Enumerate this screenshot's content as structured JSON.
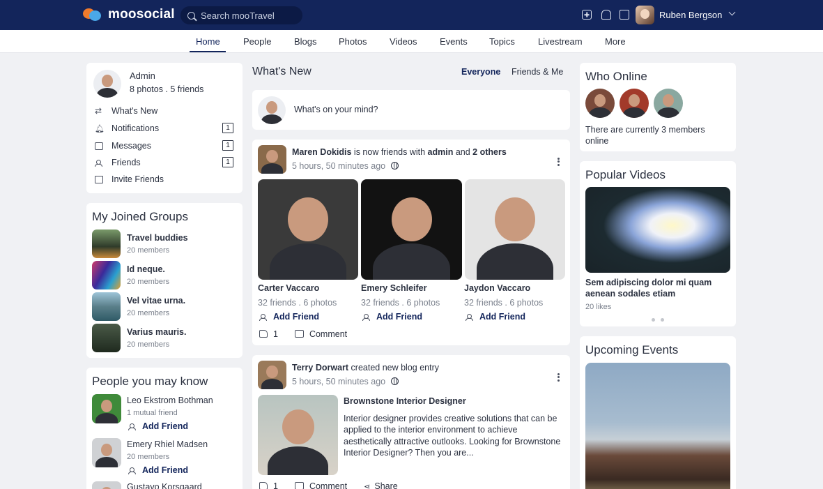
{
  "header": {
    "brand": "moosocial",
    "search_placeholder": "Search mooTravel",
    "user_name": "Ruben Bergson",
    "icons": [
      "plus-icon",
      "bell-icon",
      "chat-icon",
      "chevron-down-icon"
    ]
  },
  "nav": {
    "items": [
      "Home",
      "People",
      "Blogs",
      "Photos",
      "Videos",
      "Events",
      "Topics",
      "Livestream",
      "More"
    ],
    "active": "Home"
  },
  "profile": {
    "name": "Admin",
    "stats": "8 photos . 5 friends",
    "menu": [
      {
        "label": "What's New",
        "icon": "arrows-icon",
        "count": ""
      },
      {
        "label": "Notifications",
        "icon": "bell-icon",
        "count": "1"
      },
      {
        "label": "Messages",
        "icon": "message-icon",
        "count": "1"
      },
      {
        "label": "Friends",
        "icon": "friends-icon",
        "count": "1"
      },
      {
        "label": "Invite Friends",
        "icon": "envelope-icon",
        "count": ""
      }
    ]
  },
  "groups": {
    "title": "My Joined Groups",
    "items": [
      {
        "name": "Travel buddies",
        "members": "20 members"
      },
      {
        "name": "Id neque.",
        "members": "20 members"
      },
      {
        "name": "Vel vitae urna.",
        "members": "20 members"
      },
      {
        "name": "Varius mauris.",
        "members": "20 members"
      }
    ]
  },
  "people_know": {
    "title": "People you may know",
    "items": [
      {
        "name": "Leo Ekstrom Bothman",
        "sub": "1 mutual friend",
        "action": "Add Friend"
      },
      {
        "name": "Emery Rhiel Madsen",
        "sub": "20 members",
        "action": "Add Friend"
      },
      {
        "name": "Gustavo Korsgaard",
        "sub": "",
        "action": ""
      }
    ]
  },
  "feed": {
    "title": "What's New",
    "filters": [
      "Everyone",
      "Friends & Me"
    ],
    "active_filter": "Everyone",
    "composer_placeholder": "What's on your mind?",
    "post1": {
      "author": "Maren Dokidis",
      "text_mid": "is now friends with",
      "bold1": "admin",
      "text_and": "and",
      "bold2": "2 others",
      "time": "5 hours, 50 minutes ago",
      "friends": [
        {
          "name": "Carter Vaccaro",
          "stats": "32 friends . 6 photos",
          "action": "Add Friend"
        },
        {
          "name": "Emery Schleifer",
          "stats": "32 friends . 6 photos",
          "action": "Add Friend"
        },
        {
          "name": "Jaydon Vaccaro",
          "stats": "32 friends . 6 photos",
          "action": "Add Friend"
        }
      ],
      "likes": "1",
      "comment_label": "Comment"
    },
    "post2": {
      "author": "Terry Dorwart",
      "text": "created new blog entry",
      "time": "5 hours, 50 minutes ago",
      "blog_title": "Brownstone Interior Designer",
      "blog_excerpt": "Interior designer provides creative solutions that can be applied to the interior environment to achieve aesthetically attractive outlooks. Looking for Brownstone Interior Designer? Then you are...",
      "likes": "1",
      "comment_label": "Comment",
      "share_label": "Share"
    }
  },
  "who_online": {
    "title": "Who Online",
    "text": "There are currently 3 members online"
  },
  "popular_videos": {
    "title": "Popular Videos",
    "video_title": "Sem adipiscing dolor mi quam aenean sodales etiam",
    "likes": "20 likes"
  },
  "events": {
    "title": "Upcoming Events"
  }
}
